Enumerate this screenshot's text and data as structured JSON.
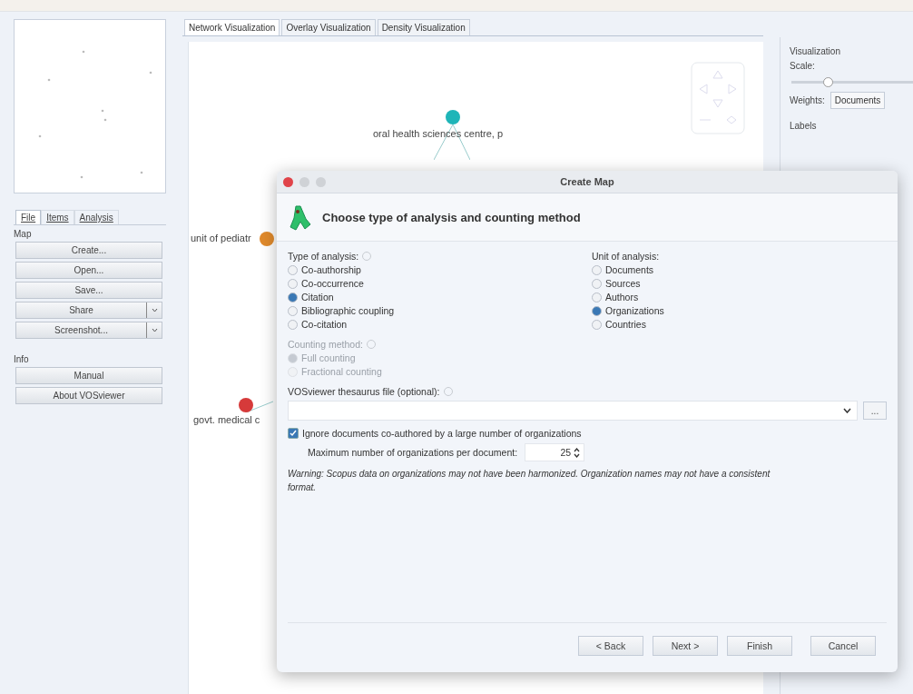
{
  "left_tabs": [
    {
      "label": "File",
      "selected": true
    },
    {
      "label": "Items",
      "selected": false
    },
    {
      "label": "Analysis",
      "selected": false
    }
  ],
  "sections": [
    {
      "title": "Map",
      "buttons": [
        {
          "label": "Create...",
          "dropdown": false
        },
        {
          "label": "Open...",
          "dropdown": false
        },
        {
          "label": "Save...",
          "dropdown": false
        },
        {
          "label": "Share",
          "dropdown": true
        },
        {
          "label": "Screenshot...",
          "dropdown": true
        }
      ]
    },
    {
      "title": "Info",
      "buttons": [
        {
          "label": "Manual",
          "dropdown": false
        },
        {
          "label": "About VOSviewer",
          "dropdown": false
        }
      ]
    }
  ],
  "view_tabs": [
    {
      "label": "Network Visualization",
      "selected": true
    },
    {
      "label": "Overlay Visualization",
      "selected": false
    },
    {
      "label": "Density Visualization",
      "selected": false
    }
  ],
  "network": {
    "nodes": [
      {
        "label": "oral health sciences centre, p",
        "color": "#1fb5b8"
      },
      {
        "label": "unit of pediatr",
        "color": "#e08a2c"
      },
      {
        "label": "govt. medical c",
        "color": "#d63a3a"
      }
    ]
  },
  "right_panel": {
    "section": "Visualization",
    "scale_label": "Scale:",
    "scale": {
      "level": 0.3
    },
    "weights_label": "Weights:",
    "weights_value": "Documents",
    "labels_section": "Labels"
  },
  "dialog": {
    "title": "Create Map",
    "heading": "Choose type of analysis and counting method",
    "groups": [
      {
        "label": "Type of analysis:",
        "help": true,
        "disabled": false,
        "options": [
          {
            "label": "Co-authorship",
            "selected": false
          },
          {
            "label": "Co-occurrence",
            "selected": false
          },
          {
            "label": "Citation",
            "selected": true
          },
          {
            "label": "Bibliographic coupling",
            "selected": false
          },
          {
            "label": "Co-citation",
            "selected": false
          }
        ]
      },
      {
        "label": "Unit of analysis:",
        "help": false,
        "disabled": false,
        "options": [
          {
            "label": "Documents",
            "selected": false
          },
          {
            "label": "Sources",
            "selected": false
          },
          {
            "label": "Authors",
            "selected": false
          },
          {
            "label": "Organizations",
            "selected": true
          },
          {
            "label": "Countries",
            "selected": false
          }
        ]
      },
      {
        "label": "Counting method:",
        "help": true,
        "disabled": true,
        "options": [
          {
            "label": "Full counting",
            "selected": true
          },
          {
            "label": "Fractional counting",
            "selected": false
          }
        ]
      }
    ],
    "thesaurus_label": "VOSviewer thesaurus file (optional):",
    "browse": "...",
    "ignore": {
      "label": "Ignore documents co-authored by a large number of organizations",
      "checked": true
    },
    "max_label": "Maximum number of organizations per document:",
    "max_value": "25",
    "warning": "Warning: Scopus data on organizations may not have been harmonized. Organization names may not have a consistent format.",
    "buttons": [
      "< Back",
      "Next >",
      "Finish",
      "Cancel"
    ]
  }
}
